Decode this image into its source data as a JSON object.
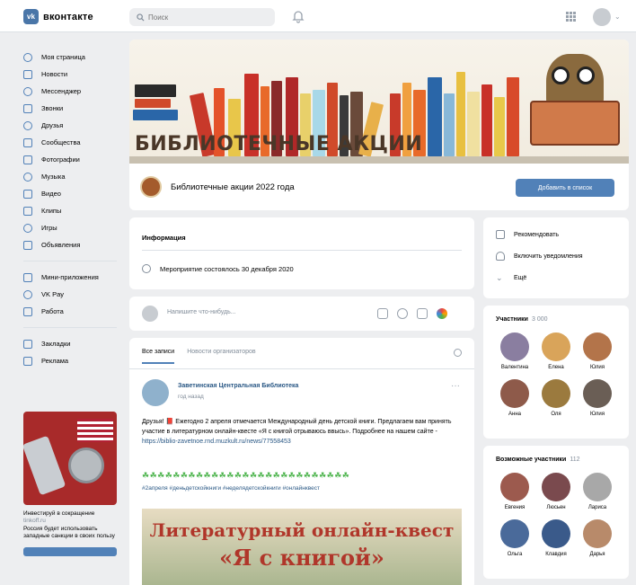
{
  "header": {
    "logo_badge": "vk",
    "logo_text": "вконтакте",
    "search_placeholder": "Поиск",
    "bell_icon": "bell-icon",
    "apps_icon": "grid-icon"
  },
  "sidebar": {
    "items": [
      {
        "label": "Моя страница",
        "icon": "user-icon"
      },
      {
        "label": "Новости",
        "icon": "news-icon"
      },
      {
        "label": "Мессенджер",
        "icon": "message-icon"
      },
      {
        "label": "Звонки",
        "icon": "phone-icon"
      },
      {
        "label": "Друзья",
        "icon": "friends-icon"
      },
      {
        "label": "Сообщества",
        "icon": "communities-icon"
      },
      {
        "label": "Фотографии",
        "icon": "photo-icon"
      },
      {
        "label": "Музыка",
        "icon": "music-icon"
      },
      {
        "label": "Видео",
        "icon": "video-icon"
      },
      {
        "label": "Клипы",
        "icon": "clips-icon"
      },
      {
        "label": "Игры",
        "icon": "games-icon"
      },
      {
        "label": "Объявления",
        "icon": "ads-icon"
      }
    ],
    "items2": [
      {
        "label": "Мини-приложения",
        "icon": "apps-icon"
      },
      {
        "label": "VK Pay",
        "icon": "pay-icon"
      },
      {
        "label": "Работа",
        "icon": "work-icon"
      }
    ],
    "items3": [
      {
        "label": "Закладки",
        "icon": "bookmark-icon"
      },
      {
        "label": "Реклама",
        "icon": "advert-icon"
      }
    ],
    "ad": {
      "title": "Инвестируй в сокращение",
      "subtitle": "tinkoff.ru",
      "text": "Россия будет использовать западные санкции в своих пользу"
    }
  },
  "cover": {
    "title": "БИБЛИОТЕЧНЫЕ АКЦИИ",
    "group_name": "Библиотечные акции 2022 года",
    "add_button": "Добавить в список"
  },
  "info": {
    "title": "Информация",
    "event": "Мероприятие состоялось 30 декабря 2020"
  },
  "actions": {
    "items": [
      {
        "label": "Рекомендовать"
      },
      {
        "label": "Включить уведомления"
      },
      {
        "label": "Ещё"
      }
    ]
  },
  "compose": {
    "placeholder": "Напишите что-нибудь..."
  },
  "feed": {
    "tab_all": "Все записи",
    "tab_org": "Новости организаторов",
    "post": {
      "author": "Заветинская Центральная Библиотека",
      "time": "год назад",
      "text": "Друзья! 📕 Ежегодно 2 апреля отмечается Международный день детской книги. Предлагаем вам принять участие в литературном онлайн-квесте «Я с книгой отрываюсь ввысь». Подробнее на нашем сайте - ",
      "link": "https://biblio-zavetnoe.rnd.muzkult.ru/news/77558453",
      "clovers": "☘☘☘☘☘☘☘☘☘☘☘☘☘☘☘☘☘☘☘☘☘☘☘☘☘☘☘",
      "hashtags": "#2апреля #деньдетскойкниги #неделядетскойкниги #онлайнквест",
      "image_title": "Литературный онлайн-квест",
      "image_sub": "«Я с книгой»"
    }
  },
  "members": {
    "title": "Участники",
    "count": "3 000",
    "people": [
      {
        "name": "Валентина",
        "color": "#8a7ea0"
      },
      {
        "name": "Елена",
        "color": "#d9a45a"
      },
      {
        "name": "Юлия",
        "color": "#b3744a"
      },
      {
        "name": "Анна",
        "color": "#8e5a4a"
      },
      {
        "name": "Оля",
        "color": "#9b7a3e"
      },
      {
        "name": "Юлия",
        "color": "#6a5e55"
      }
    ]
  },
  "possible_members": {
    "title": "Возможные участники",
    "count": "112",
    "people": [
      {
        "name": "Евгения",
        "color": "#9c5a4e"
      },
      {
        "name": "Люсьен",
        "color": "#7a4a4e"
      },
      {
        "name": "Лариса",
        "color": "#a8a8a8"
      },
      {
        "name": "Ольга",
        "color": "#4a6a9a"
      },
      {
        "name": "Клавдия",
        "color": "#3a5a8a"
      },
      {
        "name": "Дарья",
        "color": "#b88a6a"
      }
    ]
  },
  "colors": {
    "accent": "#5181b8",
    "link": "#2a5885",
    "background": "#edeef0"
  }
}
